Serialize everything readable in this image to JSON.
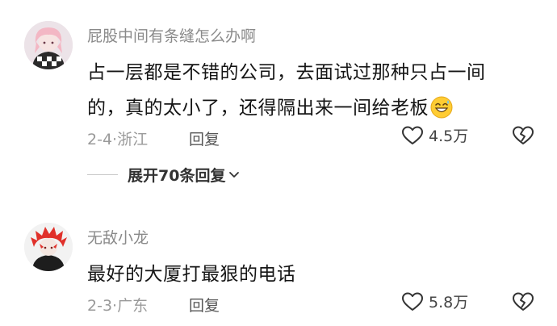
{
  "comments": [
    {
      "username": "屁股中间有条缝怎么办啊",
      "lines": [
        "占一层都是不错的公司，去面试过那种只占一间",
        "的，真的太小了，还得隔出来一间给老板"
      ],
      "date": "2-4",
      "location": "浙江",
      "reply_label": "回复",
      "likes": "4.5万",
      "replies_toggle": "展开70条回复"
    },
    {
      "username": "无敌小龙",
      "lines": [
        "最好的大厦打最狠的电话"
      ],
      "date": "2-3",
      "location": "广东",
      "reply_label": "回复",
      "likes": "5.8万"
    }
  ],
  "icons": {
    "emoji": "grinning-sweat-emoji-icon",
    "like": "heart-outline-icon",
    "dislike": "broken-heart-icon",
    "expand": "chevron-down-icon"
  },
  "colors": {
    "username": "#8a8a8a",
    "body_text": "#161616",
    "meta": "#9a9a9a",
    "avatar1_hair": "#f3b7c4",
    "avatar2_hair": "#e0312b"
  }
}
